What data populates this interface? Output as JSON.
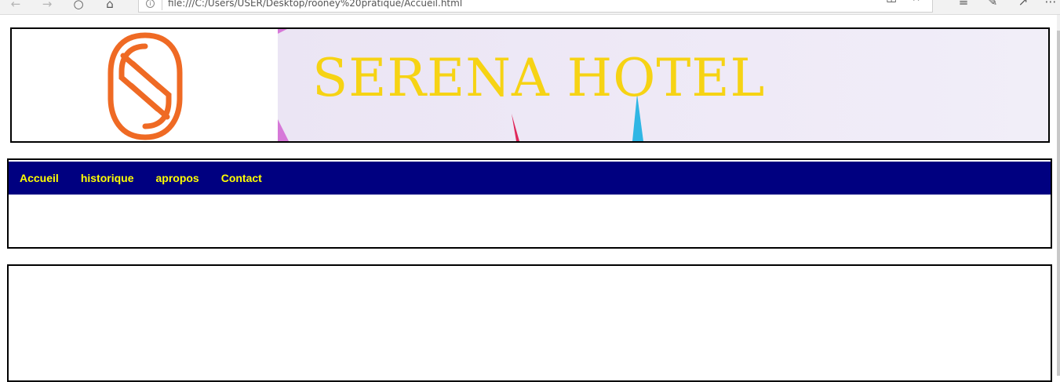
{
  "browser": {
    "url": "file:///C:/Users/USER/Desktop/rooney%20pratique/Accueil.html",
    "icons": [
      "back-icon",
      "forward-icon",
      "refresh-icon",
      "home-icon",
      "info-icon",
      "reading-view-icon",
      "favorite-star-icon",
      "favorites-list-icon",
      "annotate-pen-icon",
      "share-icon",
      "more-icon"
    ]
  },
  "banner": {
    "title": "SERENA HOTEL",
    "colors": {
      "title": "#f6d314",
      "logo": "#ef6a24",
      "background": "#ebe5f4"
    }
  },
  "nav": {
    "items": [
      {
        "label": "Accueil"
      },
      {
        "label": "historique"
      },
      {
        "label": "apropos"
      },
      {
        "label": "Contact"
      }
    ],
    "colors": {
      "bar": "#000080",
      "text": "#ffff00"
    }
  }
}
